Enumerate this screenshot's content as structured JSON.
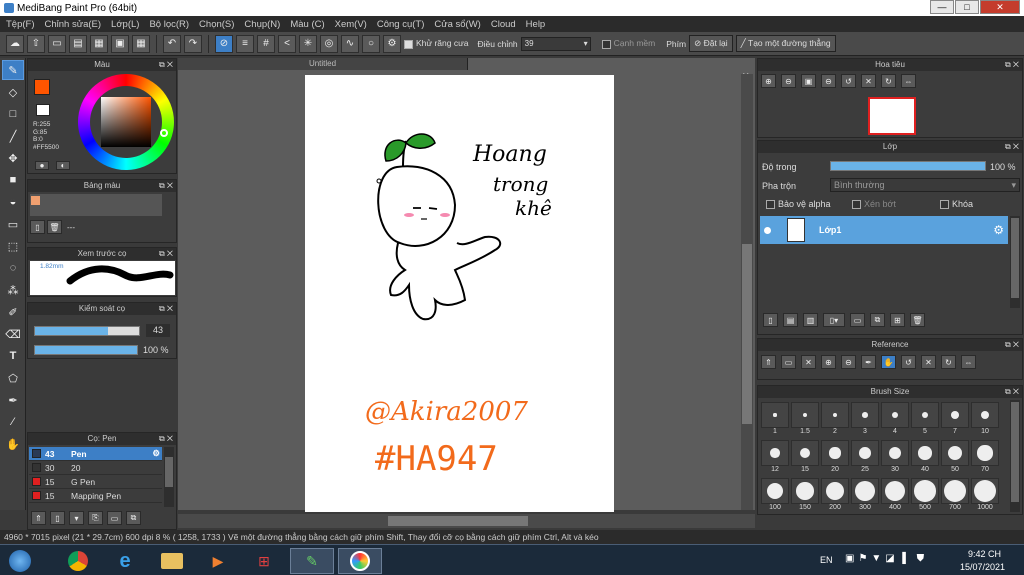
{
  "window": {
    "title": "MediBang Paint Pro (64bit)",
    "btn_min": "—",
    "btn_max": "□",
    "btn_close": "✕"
  },
  "menu": [
    "Tệp(F)",
    "Chỉnh sửa(E)",
    "Lớp(L)",
    "Bộ lọc(R)",
    "Chọn(S)",
    "Chụp(N)",
    "Màu (C)",
    "Xem(V)",
    "Công cụ(T)",
    "Cửa sổ(W)",
    "Cloud",
    "Help"
  ],
  "toolbar": {
    "antialias_label": "Khử răng cưa",
    "correction_label": "Điều chỉnh",
    "correction_value": "39",
    "snap_label": "Cạnh mềm",
    "phim_label": "Phím",
    "reset_label": "Đặt lại",
    "create_line_label": "Tạo một đường thẳng"
  },
  "color_panel": {
    "title": "Màu",
    "r": "R:255",
    "g": "G:85",
    "b": "B:0",
    "hex": "#FF5500",
    "fg_color": "#FF5500",
    "bg_color": "#FFFFFF"
  },
  "palette_panel": {
    "title": "Bảng màu",
    "swatch_color": "#F0A070",
    "label": "---"
  },
  "brush_preview_panel": {
    "title": "Xem trước cọ",
    "size": "1.82mm"
  },
  "brush_control_panel": {
    "title": "Kiểm soát cọ",
    "size_value": "43",
    "size_fraction": 0.7,
    "opacity_value": "100 %",
    "opacity_fraction": 1.0
  },
  "brush_list_panel": {
    "title": "Cọ: Pen",
    "items": [
      {
        "size": "43",
        "name": "Pen",
        "color": "#2a3a55",
        "selected": true
      },
      {
        "size": "30",
        "name": "20",
        "color": "#333333",
        "selected": false
      },
      {
        "size": "15",
        "name": "G Pen",
        "color": "#e02020",
        "selected": false
      },
      {
        "size": "15",
        "name": "Mapping Pen",
        "color": "#e02020",
        "selected": false
      }
    ]
  },
  "canvas": {
    "tab": "Untitled"
  },
  "navigator_panel": {
    "title": "Hoa tiêu"
  },
  "layer_panel": {
    "title": "Lớp",
    "opacity_label": "Độ trong",
    "opacity_value": "100 %",
    "opacity_fraction": 1.0,
    "blend_label": "Pha trộn",
    "blend_value": "Bình thường",
    "protect_alpha": "Bảo vệ alpha",
    "clipping": "Xén bớt",
    "lock": "Khóa",
    "layers": [
      {
        "name": "Lớp1"
      }
    ]
  },
  "reference_panel": {
    "title": "Reference"
  },
  "brush_size_panel": {
    "title": "Brush Size",
    "sizes": [
      "1",
      "1.5",
      "2",
      "3",
      "4",
      "5",
      "7",
      "10",
      "12",
      "15",
      "20",
      "25",
      "30",
      "40",
      "50",
      "70",
      "100",
      "150",
      "200",
      "300",
      "400",
      "500",
      "700",
      "1000"
    ]
  },
  "status": {
    "text": "4960 * 7015 pixel   (21 * 29.7cm)   600 dpi   8 %   ( 1258, 1733 )   Vẽ một đường thẳng bằng cách giữ phím Shift, Thay đổi cỡ cọ bằng cách giữ phím Ctrl, Alt và kéo"
  },
  "taskbar": {
    "lang": "EN",
    "time": "9:42 CH",
    "date": "15/07/2021"
  },
  "drawing": {
    "text1": "Hoang",
    "text2": "trong",
    "text3": "khê",
    "signature": "@Akira2007",
    "hashtag": "#HA947",
    "ink_color": "#000000",
    "orange": "#F26A1B",
    "green": "#2a9a2a"
  }
}
